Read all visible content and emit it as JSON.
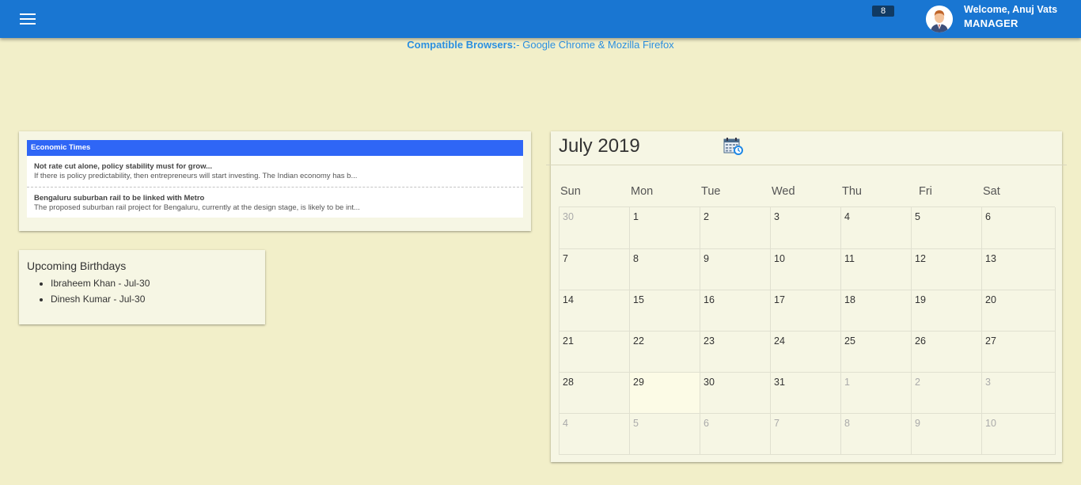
{
  "header": {
    "notification_count": "8",
    "welcome": "Welcome, Anuj Vats",
    "role": "MANAGER"
  },
  "compat": {
    "label": "Compatible Browsers:",
    "text": "- Google Chrome & Mozilla Firefox"
  },
  "news": {
    "source": "Economic Times",
    "items": [
      {
        "title": "Not rate cut alone, policy stability must for grow...",
        "desc": "If there is policy predictability, then entrepreneurs will start investing. The Indian economy has b..."
      },
      {
        "title": "Bengaluru suburban rail to be linked with Metro",
        "desc": "The proposed suburban rail project for Bengaluru, currently at the design stage, is likely to be int..."
      }
    ]
  },
  "birthdays": {
    "title": "Upcoming Birthdays",
    "items": [
      "Ibraheem Khan - Jul-30",
      "Dinesh Kumar - Jul-30"
    ]
  },
  "calendar": {
    "title": "July 2019",
    "weekdays": [
      "Sun",
      "Mon",
      "Tue",
      "Wed",
      "Thu",
      "Fri",
      "Sat"
    ],
    "weeks": [
      [
        "30",
        "1",
        "2",
        "3",
        "4",
        "5",
        "6"
      ],
      [
        "7",
        "8",
        "9",
        "10",
        "11",
        "12",
        "13"
      ],
      [
        "14",
        "15",
        "16",
        "17",
        "18",
        "19",
        "20"
      ],
      [
        "21",
        "22",
        "23",
        "24",
        "25",
        "26",
        "27"
      ],
      [
        "28",
        "29",
        "30",
        "31",
        "1",
        "2",
        "3"
      ],
      [
        "4",
        "5",
        "6",
        "7",
        "8",
        "9",
        "10"
      ]
    ],
    "other_month": [
      [
        0,
        0
      ],
      [
        4,
        4
      ],
      [
        4,
        5
      ],
      [
        4,
        6
      ],
      [
        5,
        0
      ],
      [
        5,
        1
      ],
      [
        5,
        2
      ],
      [
        5,
        3
      ],
      [
        5,
        4
      ],
      [
        5,
        5
      ],
      [
        5,
        6
      ]
    ],
    "today": [
      4,
      1
    ]
  },
  "colors": {
    "header_bg": "#1976d2",
    "page_bg": "#f2efc9",
    "news_header_bg": "#2f66f6",
    "link": "#2b8fe0"
  }
}
